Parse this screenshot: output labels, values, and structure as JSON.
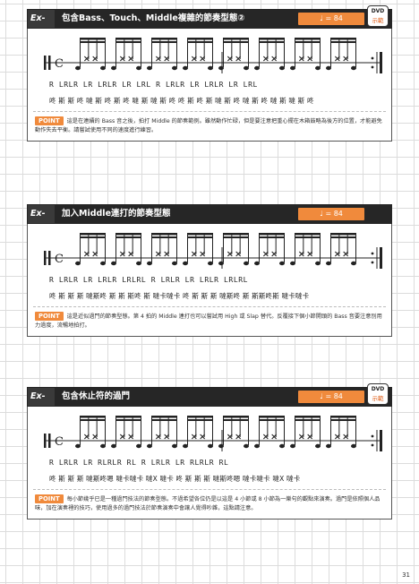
{
  "examples": [
    {
      "id": "Ex-27",
      "title": "包含Bass、Touch、Middle複雜的節奏型態②",
      "tempo": "♩ = 84",
      "dvd": true,
      "sticking": "R LRLR LR LRLR LR LRL  R LRLR LR LRLR LR LRL",
      "voice": "咚 斯 斯 咚  噠 斯 咚 斯 咚  噠 斯 噠 斯 咚  咚 斯 咚 斯  噠 斯 咚 噠 斯  咚  噠 斯 噠 斯 咚",
      "point": "這是在連續的 Bass 音之後，拍打 Middle 的節奏範例。雖然動作忙碌，但是要注意把重心擺在木箱鼓略為後方的位置，才能避免動作失去平衡。請嘗試使用不同的速度進行練習。"
    },
    {
      "id": "Ex-28",
      "title": "加入Middle連打的節奏型態",
      "tempo": "♩ = 84",
      "dvd": false,
      "sticking": "R LRLR LR LRLR LRLRL  R LRLR LR LRLR LRLRL",
      "voice": "咚 斯 斯 斯  噠斯咚 斯 斯 斯咚 斯  噠卡噠卡  咚 斯 斯 斯  噠斯咚 斯  斯斯咚斯  噠卡噠卡",
      "point": "這是近似過門的節奏型態。第 4 拍的 Middle 連打也可以嘗試用 High 或 Slap 替代。反覆接下個小節開頭的 Bass 音要注意別用力過度，流暢地拍打。"
    },
    {
      "id": "Ex-29",
      "title": "包含休止符的過門",
      "tempo": "♩ = 84",
      "dvd": true,
      "sticking": "R LRLR LR   RLRLR   RL   R LRLR LR   RLRLR   RL",
      "voice": "咚 斯 斯 斯  噠斯咚嗯  噠卡噠卡  噠X  噠卡  咚 斯 斯 斯  噠斯咚嗯  噠卡噠卡  噠X  噠卡",
      "point": "每小節幾乎已是一種過門技法的節奏型態。不過希望各位仍是以這是 4 小節或 8 小節為一樂句的觀點來演奏。過門是依照個人品味，加在演奏裡的技巧，使用過多的過門技法於節奏演奏中會讓人覺得吵雜，這點請注意。"
    }
  ],
  "labels": {
    "dvd_line1": "DVD",
    "dvd_line2": "示範",
    "point_tag": "POINT"
  },
  "page_number": "31"
}
